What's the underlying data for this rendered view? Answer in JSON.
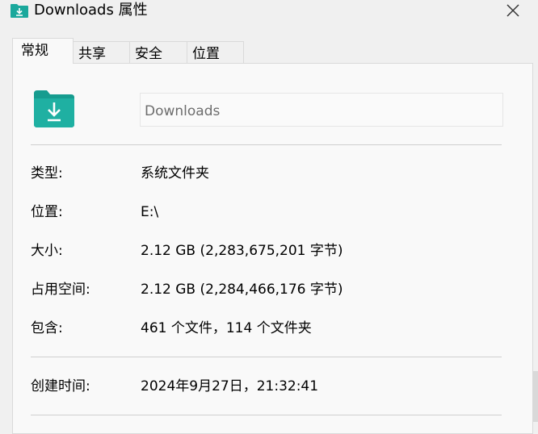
{
  "window": {
    "title": "Downloads 属性",
    "close_icon": "close-icon",
    "title_icon": "downloads-folder-icon",
    "accent_color": "#1aa89c"
  },
  "tabs": [
    {
      "label": "常规",
      "active": true
    },
    {
      "label": "共享",
      "active": false
    },
    {
      "label": "安全",
      "active": false
    },
    {
      "label": "位置",
      "active": false
    }
  ],
  "folder": {
    "icon": "downloads-folder-icon",
    "name": "Downloads"
  },
  "properties": {
    "type_label": "类型:",
    "type_value": "系统文件夹",
    "location_label": "位置:",
    "location_value": "E:\\",
    "size_label": "大小:",
    "size_value": "2.12 GB (2,283,675,201 字节)",
    "size_on_disk_label": "占用空间:",
    "size_on_disk_value": "2.12 GB (2,284,466,176 字节)",
    "contains_label": "包含:",
    "contains_value": "461 个文件，114 个文件夹",
    "created_label": "创建时间:",
    "created_value": "2024年9月27日，21:32:41"
  }
}
